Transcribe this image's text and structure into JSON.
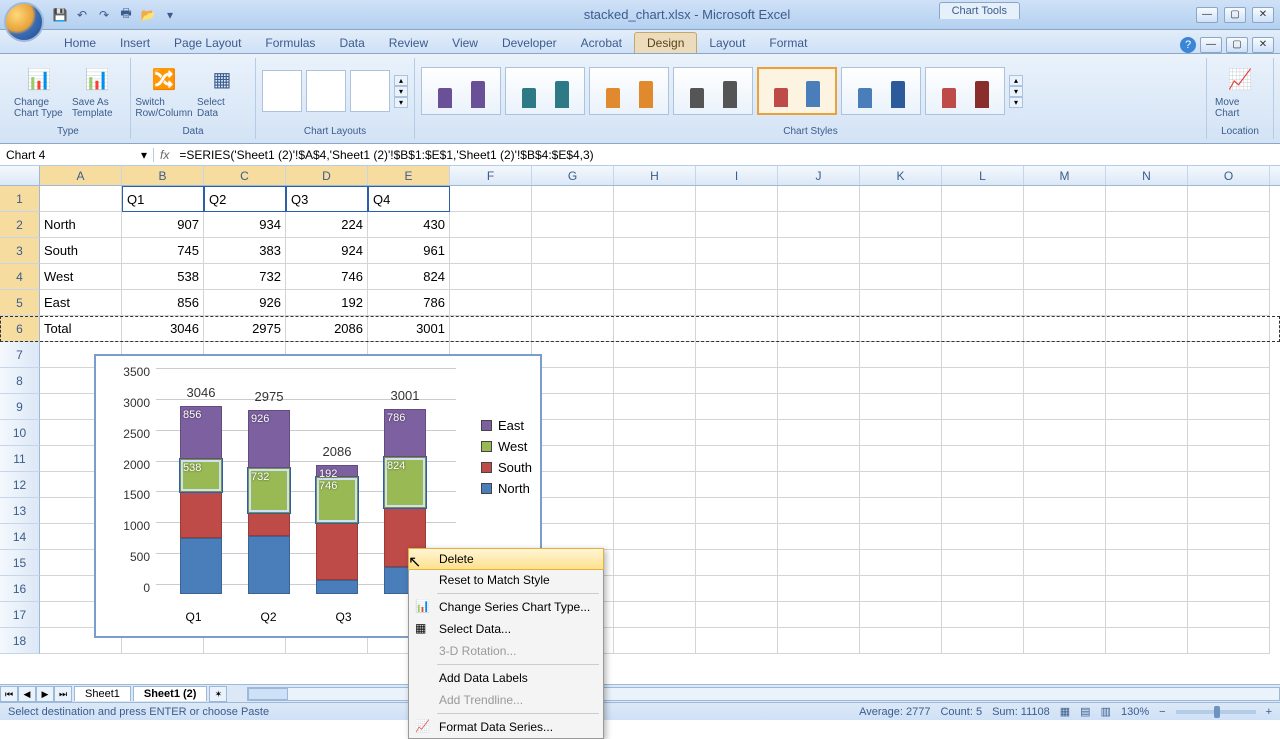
{
  "title": "stacked_chart.xlsx - Microsoft Excel",
  "chart_tools_label": "Chart Tools",
  "tabs": [
    "Home",
    "Insert",
    "Page Layout",
    "Formulas",
    "Data",
    "Review",
    "View",
    "Developer",
    "Acrobat",
    "Design",
    "Layout",
    "Format"
  ],
  "active_tab": "Design",
  "ribbon": {
    "type_group": "Type",
    "change_chart_type": "Change Chart Type",
    "save_as_template": "Save As Template",
    "data_group": "Data",
    "switch_rowcol": "Switch Row/Column",
    "select_data": "Select Data",
    "chart_layouts": "Chart Layouts",
    "chart_styles": "Chart Styles",
    "location": "Location",
    "move_chart": "Move Chart"
  },
  "name_box": "Chart 4",
  "formula": "=SERIES('Sheet1 (2)'!$A$4,'Sheet1 (2)'!$B$1:$E$1,'Sheet1 (2)'!$B$4:$E$4,3)",
  "columns": [
    "A",
    "B",
    "C",
    "D",
    "E",
    "F",
    "G",
    "H",
    "I",
    "J",
    "K",
    "L",
    "M",
    "N",
    "O"
  ],
  "sheet": {
    "headers": [
      "",
      "Q1",
      "Q2",
      "Q3",
      "Q4"
    ],
    "rows": [
      {
        "label": "North",
        "vals": [
          907,
          934,
          224,
          430
        ]
      },
      {
        "label": "South",
        "vals": [
          745,
          383,
          924,
          961
        ]
      },
      {
        "label": "West",
        "vals": [
          538,
          732,
          746,
          824
        ]
      },
      {
        "label": "East",
        "vals": [
          856,
          926,
          192,
          786
        ]
      },
      {
        "label": "Total",
        "vals": [
          3046,
          2975,
          2086,
          3001
        ]
      }
    ]
  },
  "chart_data": {
    "type": "bar",
    "stacked": true,
    "categories": [
      "Q1",
      "Q2",
      "Q3",
      "Q4"
    ],
    "series": [
      {
        "name": "North",
        "values": [
          907,
          934,
          224,
          430
        ],
        "color": "#4a7ebb"
      },
      {
        "name": "South",
        "values": [
          745,
          383,
          924,
          961
        ],
        "color": "#be4b48"
      },
      {
        "name": "West",
        "values": [
          538,
          732,
          746,
          824
        ],
        "color": "#98b954"
      },
      {
        "name": "East",
        "values": [
          856,
          926,
          192,
          786
        ],
        "color": "#7d60a0"
      }
    ],
    "totals": [
      3046,
      2975,
      2086,
      3001
    ],
    "ylim": [
      0,
      3500
    ],
    "ystep": 500,
    "legend_order": [
      "East",
      "West",
      "South",
      "North"
    ]
  },
  "context_menu": [
    {
      "label": "Delete",
      "highlight": true
    },
    {
      "label": "Reset to Match Style"
    },
    {
      "sep": true
    },
    {
      "label": "Change Series Chart Type...",
      "icon": "📊"
    },
    {
      "label": "Select Data...",
      "icon": "▦"
    },
    {
      "label": "3-D Rotation...",
      "disabled": true
    },
    {
      "sep": true
    },
    {
      "label": "Add Data Labels"
    },
    {
      "label": "Add Trendline...",
      "disabled": true
    },
    {
      "sep": true
    },
    {
      "label": "Format Data Series...",
      "icon": "📈"
    }
  ],
  "sheet_tabs": [
    "Sheet1",
    "Sheet1 (2)"
  ],
  "active_sheet": "Sheet1 (2)",
  "status_left": "Select destination and press ENTER or choose Paste",
  "status_agg": {
    "average": "Average: 2777",
    "count": "Count: 5",
    "sum": "Sum: 11108"
  },
  "zoom": "130%"
}
